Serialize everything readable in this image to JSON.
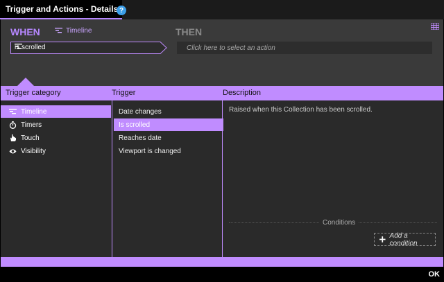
{
  "window": {
    "title": "Trigger and Actions - Details",
    "help_icon": "?",
    "ok_label": "OK"
  },
  "when": {
    "label": "WHEN",
    "scope_label": "Timeline",
    "scope_icon": "timeline-icon",
    "trigger_value": "is scrolled"
  },
  "then": {
    "label": "THEN",
    "action_placeholder": "Click here to select an action"
  },
  "columns": {
    "category_header": "Trigger category",
    "trigger_header": "Trigger",
    "description_header": "Description"
  },
  "categories": [
    {
      "label": "Timeline",
      "icon": "timeline-icon",
      "selected": true
    },
    {
      "label": "Timers",
      "icon": "stopwatch-icon",
      "selected": false
    },
    {
      "label": "Touch",
      "icon": "hand-icon",
      "selected": false
    },
    {
      "label": "Visibility",
      "icon": "eye-icon",
      "selected": false
    }
  ],
  "triggers": [
    {
      "label": "Date changes",
      "selected": false
    },
    {
      "label": "Is scrolled",
      "selected": true
    },
    {
      "label": "Reaches date",
      "selected": false
    },
    {
      "label": "Viewport is changed",
      "selected": false
    }
  ],
  "description": {
    "text": "Raised when this Collection has been scrolled.",
    "conditions_label": "Conditions",
    "add_condition_label": "Add a condition"
  },
  "colors": {
    "accent": "#c08cff",
    "title_accent": "#b687ff",
    "help": "#3b9ee8"
  }
}
